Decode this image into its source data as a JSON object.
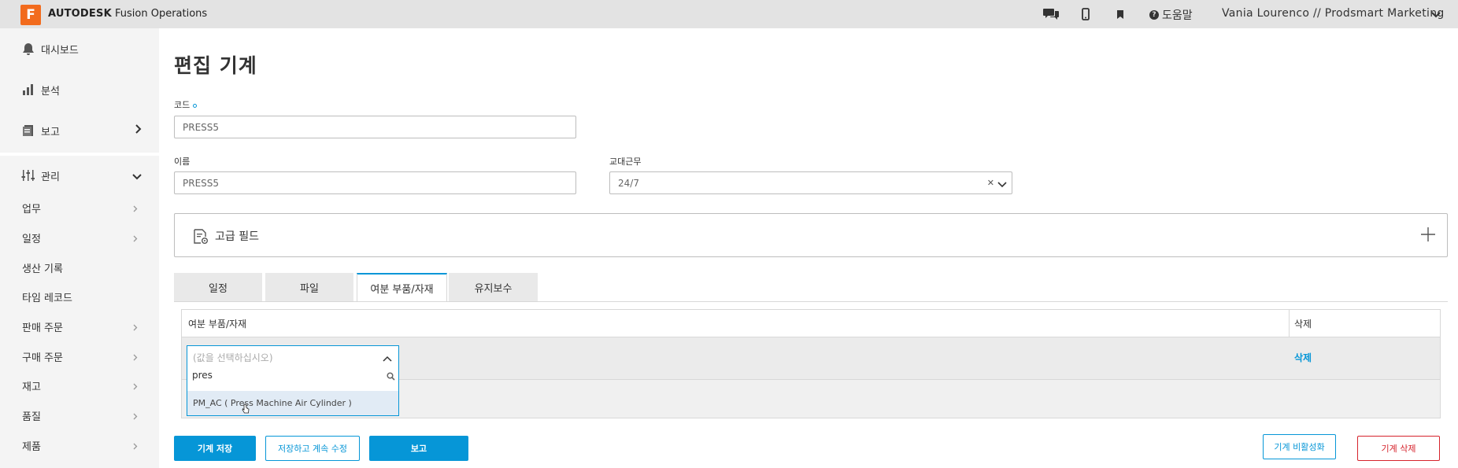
{
  "header": {
    "logo_letter": "F",
    "brand_bold": "AUTODESK",
    "brand_rest": " Fusion Operations",
    "help_label": "도움말",
    "user_label": "Vania Lourenco // Prodsmart Marketing"
  },
  "sidebar": {
    "main": [
      {
        "label": "대시보드",
        "icon": "bell-icon"
      },
      {
        "label": "분석",
        "icon": "bar-chart-icon"
      },
      {
        "label": "보고",
        "icon": "report-icon"
      },
      {
        "label": "관리",
        "icon": "sliders-icon"
      }
    ],
    "sub": [
      "업무",
      "일정",
      "생산 기록",
      "타임 레코드",
      "판매 주문",
      "구매 주문",
      "재고",
      "품질",
      "제품"
    ]
  },
  "form": {
    "title": "편집 기계",
    "code_label": "코드",
    "code_value": "PRESS5",
    "name_label": "이름",
    "name_value": "PRESS5",
    "shift_label": "교대근무",
    "shift_value": "24/7",
    "advanced_label": "고급 필드"
  },
  "tabs": [
    "일정",
    "파일",
    "여분 부품/자재",
    "유지보수"
  ],
  "table": {
    "col_parts": "여분 부품/자재",
    "col_delete": "삭제",
    "delete_link": "삭제"
  },
  "dropdown": {
    "placeholder": "(값을 선택하십시오)",
    "search_value": "pres",
    "option": "PM_AC ( Press Machine Air Cylinder )"
  },
  "buttons": {
    "save": "기계 저장",
    "save_continue": "저장하고 계속 수정",
    "report": "보고",
    "deactivate": "기계 비활성화",
    "delete": "기계 삭제"
  },
  "colors": {
    "accent": "#0696d7",
    "danger": "#d6232c",
    "logo": "#f26b1d"
  }
}
